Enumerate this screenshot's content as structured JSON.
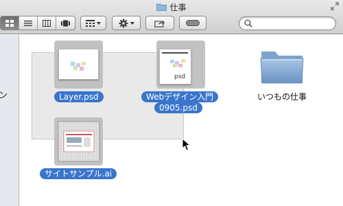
{
  "window": {
    "title": "仕事"
  },
  "toolbar": {
    "view_buttons": [
      "icon-view",
      "list-view",
      "column-view",
      "coverflow-view"
    ],
    "active_view": "icon-view",
    "arrange_icon": "arrange-grid-icon",
    "action_icon": "gear-icon",
    "share_icon": "share-icon",
    "tag_icon": "tag-toggle-icon",
    "search_placeholder": ""
  },
  "sidebar": {
    "partial_label": "ン"
  },
  "files": [
    {
      "name": "Layer.psd",
      "selected": true,
      "kind": "psd"
    },
    {
      "name_line1": "Webデザイン入門",
      "name_line2": "0905.psd",
      "ext_label": "psd",
      "selected": true,
      "kind": "psd"
    },
    {
      "name": "いつもの仕事",
      "selected": false,
      "kind": "folder"
    },
    {
      "name": "サイトサンプル.ai",
      "selected": true,
      "kind": "ai"
    }
  ],
  "colors": {
    "selection_label": "#3a75cd",
    "folder_blue": "#7fa6cf"
  }
}
